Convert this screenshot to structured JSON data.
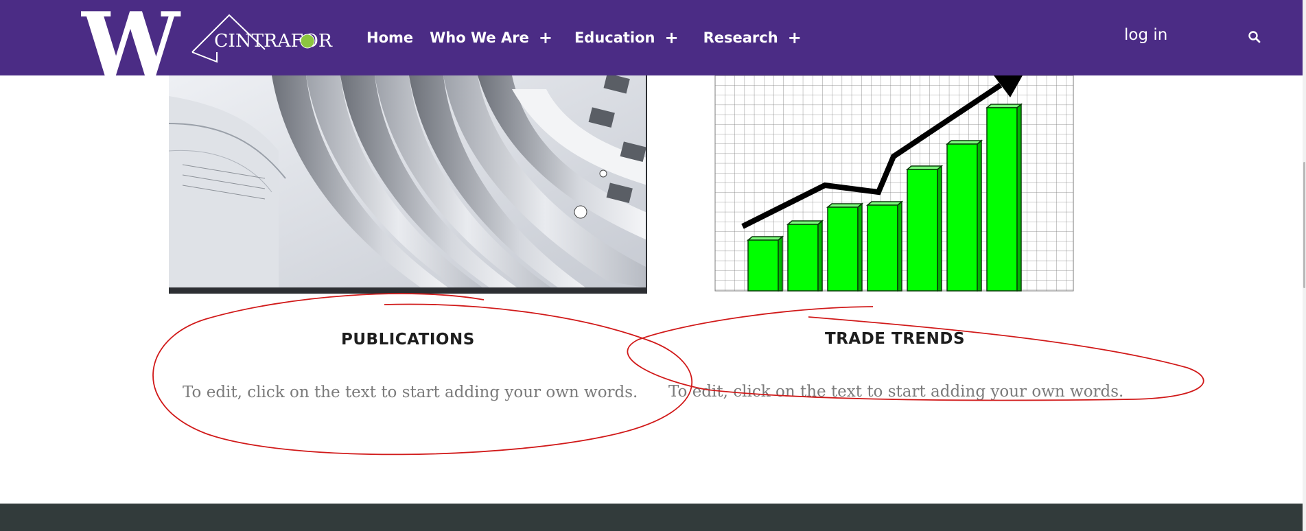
{
  "header": {
    "logo_w_text": "W",
    "logo_name_text": "CINTRAFOR",
    "nav": [
      {
        "label": "Home",
        "has_submenu": false
      },
      {
        "label": "Who We Are",
        "has_submenu": true
      },
      {
        "label": "Education",
        "has_submenu": true
      },
      {
        "label": "Research",
        "has_submenu": true
      }
    ],
    "submenu_glyph": "+",
    "login_label": "log in",
    "search_icon": "search-icon"
  },
  "sections": [
    {
      "title": "PUBLICATIONS",
      "text": "To edit, click on the text to start adding your own words.",
      "image": "open-book-pages-image"
    },
    {
      "title": "TRADE TRENDS",
      "text": "To edit, click on the text to start adding your own words.",
      "image": "rising-bar-chart-image"
    }
  ],
  "colors": {
    "header_bg": "#4b2c85",
    "footer_bg": "#323b3b",
    "annotation_red": "#d11a1a",
    "bar_green": "#00ff00"
  }
}
